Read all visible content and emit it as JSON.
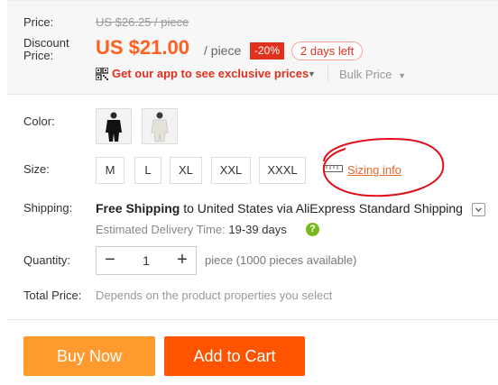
{
  "price": {
    "label": "Price:",
    "original": "US $26.25 / piece",
    "discount_label_line1": "Discount",
    "discount_label_line2": "Price:",
    "current": "US $21.00",
    "unit": "/ piece",
    "discount_badge": "-20%",
    "time_left": "2 days left",
    "app_promo": "Get our app to see exclusive prices",
    "bulk_price": "Bulk Price"
  },
  "color": {
    "label": "Color:",
    "options": [
      "black",
      "white"
    ]
  },
  "size": {
    "label": "Size:",
    "options": [
      "M",
      "L",
      "XL",
      "XXL",
      "XXXL"
    ],
    "sizing_info": "Sizing info"
  },
  "shipping": {
    "label": "Shipping:",
    "free_text": "Free Shipping",
    "to_text": "to United States via AliExpress Standard Shipping",
    "est_label": "Estimated Delivery Time:",
    "est_days": "19-39 days",
    "help": "?"
  },
  "quantity": {
    "label": "Quantity:",
    "value": "1",
    "minus": "−",
    "plus": "+",
    "available": "piece (1000 pieces available)"
  },
  "total": {
    "label": "Total Price:",
    "value": "Depends on the product properties you select"
  },
  "actions": {
    "buy_now": "Buy Now",
    "add_to_cart": "Add to Cart"
  },
  "colors": {
    "price_accent": "#ff5f1f",
    "red": "#e0301e",
    "buy_now": "#fe9a2e",
    "add_to_cart": "#ff5300",
    "annotation_circle": "#e0101a"
  }
}
